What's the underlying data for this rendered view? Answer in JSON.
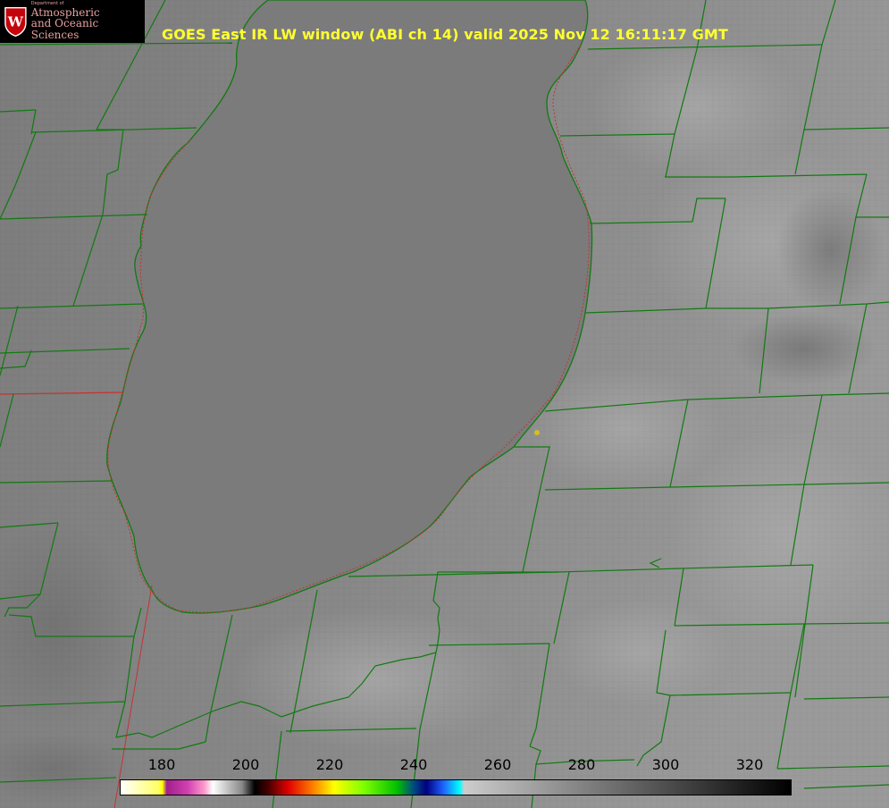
{
  "logo": {
    "dept": "Department of",
    "line1": "Atmospheric",
    "line2": "and Oceanic Sciences",
    "crest_letter": "W"
  },
  "title": "GOES East IR LW window (ABI ch 14) valid 2025 Nov 12 16:11:17 GMT",
  "colorbar": {
    "min": 170,
    "max": 330,
    "ticks": [
      "180",
      "200",
      "220",
      "240",
      "260",
      "280",
      "300",
      "320"
    ],
    "stops": [
      {
        "v": 170,
        "c": "#ffffff"
      },
      {
        "v": 179,
        "c": "#ffff66"
      },
      {
        "v": 180,
        "c": "#ffff00"
      },
      {
        "v": 181,
        "c": "#a0208c"
      },
      {
        "v": 186,
        "c": "#d040b0"
      },
      {
        "v": 190,
        "c": "#ff99cc"
      },
      {
        "v": 192,
        "c": "#ffffff"
      },
      {
        "v": 199,
        "c": "#888888"
      },
      {
        "v": 202,
        "c": "#000000"
      },
      {
        "v": 205,
        "c": "#400000"
      },
      {
        "v": 210,
        "c": "#e00000"
      },
      {
        "v": 216,
        "c": "#ff8000"
      },
      {
        "v": 221,
        "c": "#ffff00"
      },
      {
        "v": 228,
        "c": "#80ff00"
      },
      {
        "v": 236,
        "c": "#00c000"
      },
      {
        "v": 240,
        "c": "#004a80"
      },
      {
        "v": 243,
        "c": "#000080"
      },
      {
        "v": 247,
        "c": "#2060ff"
      },
      {
        "v": 251,
        "c": "#00ffff"
      },
      {
        "v": 252,
        "c": "#cccccc"
      },
      {
        "v": 330,
        "c": "#000000"
      }
    ]
  },
  "colors": {
    "county_lines": "#117a11",
    "state_line": "#c83232",
    "marker": "#d2c020",
    "lake": "#7b7b7b"
  },
  "icons": {
    "logo": "uw-crest-icon",
    "marker": "station-dot-icon"
  }
}
